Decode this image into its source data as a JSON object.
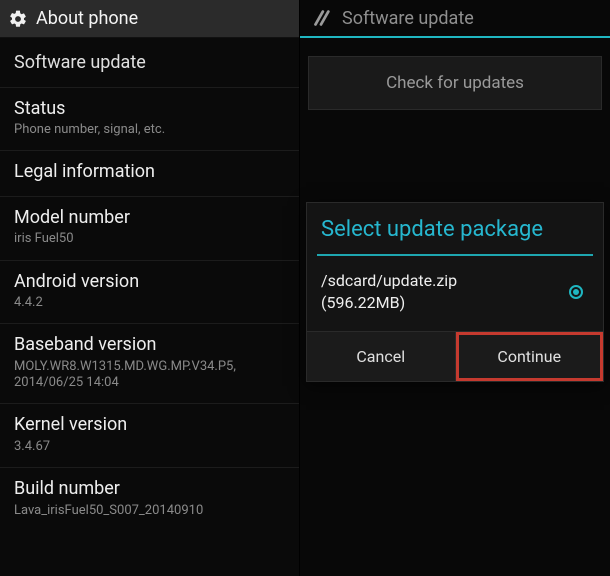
{
  "left": {
    "header_title": "About phone",
    "items": [
      {
        "label": "Software update",
        "sub": ""
      },
      {
        "label": "Status",
        "sub": "Phone number, signal, etc."
      },
      {
        "label": "Legal information",
        "sub": ""
      },
      {
        "label": "Model number",
        "sub": "iris Fuel50"
      },
      {
        "label": "Android version",
        "sub": "4.4.2"
      },
      {
        "label": "Baseband version",
        "sub": "MOLY.WR8.W1315.MD.WG.MP.V34.P5, 2014/06/25 14:04"
      },
      {
        "label": "Kernel version",
        "sub": "3.4.67"
      },
      {
        "label": "Build number",
        "sub": "Lava_irisFuel50_S007_20140910"
      }
    ]
  },
  "right": {
    "header_title": "Software update",
    "check_label": "Check for updates"
  },
  "dialog": {
    "title": "Select update package",
    "package_path": "/sdcard/update.zip",
    "package_size": "(596.22MB)",
    "cancel_label": "Cancel",
    "continue_label": "Continue"
  },
  "colors": {
    "accent": "#1fb6c1",
    "highlight_box": "#c53a2f"
  }
}
